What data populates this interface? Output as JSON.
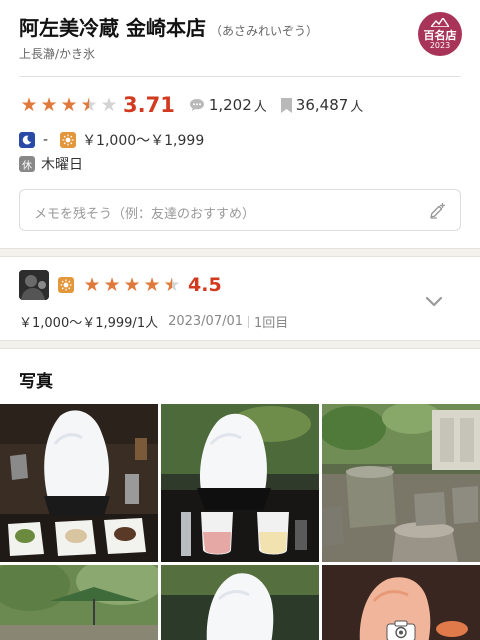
{
  "restaurant": {
    "name": "阿左美冷蔵 金崎本店",
    "kana": "（あさみれいぞう）",
    "area_genre": "上長瀞/かき氷",
    "badge": {
      "line1": "百名店",
      "line2": "2023"
    }
  },
  "rating": {
    "score": "3.71",
    "stars": 3.5,
    "reviews_count": "1,202",
    "reviews_unit": "人",
    "bookmarks_count": "36,487",
    "bookmarks_unit": "人"
  },
  "budget": {
    "dinner": "-",
    "lunch": "￥1,000～￥1,999"
  },
  "closed": {
    "icon_label": "休",
    "days": "木曜日"
  },
  "memo": {
    "placeholder": "メモを残そう（例：友達のおすすめ）"
  },
  "review": {
    "stars": 4.5,
    "score": "4.5",
    "price": "￥1,000～￥1,999/1人",
    "date": "2023/07/01",
    "visit": "1回目"
  },
  "photos": {
    "heading": "写真"
  },
  "colors": {
    "star": "#e07a3c",
    "score": "#d23a1f",
    "badge": "#a8345a",
    "dinner_icon": "#2b4aa8",
    "lunch_icon": "#e2973b"
  },
  "icons": [
    "comment-icon",
    "bookmark-icon",
    "moon-icon",
    "sun-icon",
    "pencil-plus-icon",
    "chevron-down-icon",
    "camera-icon"
  ]
}
